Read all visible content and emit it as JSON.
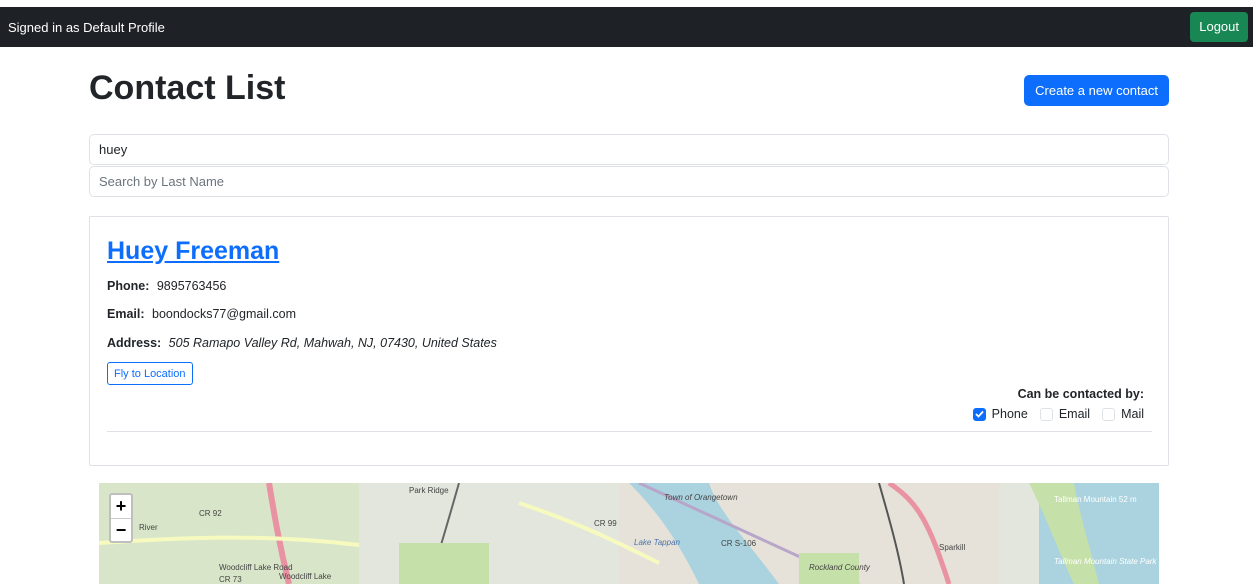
{
  "topbar": {
    "signed_in_text": "Signed in as Default Profile",
    "logout_label": "Logout"
  },
  "header": {
    "title": "Contact List",
    "create_label": "Create a new contact"
  },
  "search": {
    "first_name_value": "huey",
    "last_name_placeholder": "Search by Last Name"
  },
  "contact": {
    "name": "Huey Freeman",
    "phone_label": "Phone:",
    "phone": "9895763456",
    "email_label": "Email:",
    "email": "boondocks77@gmail.com",
    "address_label": "Address:",
    "address": "505 Ramapo Valley Rd, Mahwah, NJ, 07430, United States",
    "fly_label": "Fly to Location",
    "contact_by_label": "Can be contacted by:",
    "options": [
      {
        "label": "Phone",
        "checked": true
      },
      {
        "label": "Email",
        "checked": false
      },
      {
        "label": "Mail",
        "checked": false
      }
    ]
  },
  "map": {
    "zoom_in": "+",
    "zoom_out": "−",
    "labels": [
      "Park Ridge",
      "CR 92",
      "River",
      "CR 99",
      "Lake Tappan",
      "CR S-106",
      "Sparkill",
      "Tallman Mountain 52 m",
      "Tallman Mountain State Park",
      "Woodcliff Lake",
      "Woodcliff Lake Road",
      "CR 73",
      "Town of Orangetown",
      "Rockland County"
    ]
  },
  "colors": {
    "accent": "#0d6efd",
    "logout": "#198754",
    "topbar": "#1e2125"
  }
}
